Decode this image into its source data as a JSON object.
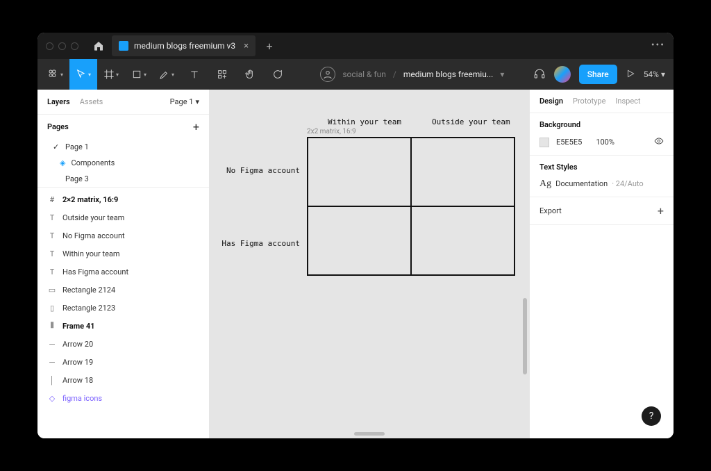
{
  "tabbar": {
    "title": "medium blogs freemium v3"
  },
  "toolbar": {
    "project": "social & fun",
    "file": "medium blogs freemiu...",
    "share": "Share",
    "zoom": "54%"
  },
  "leftPanel": {
    "tabs": {
      "layers": "Layers",
      "assets": "Assets",
      "pagePicker": "Page 1"
    },
    "pagesHeader": "Pages",
    "pages": [
      {
        "label": "Page 1",
        "checked": true
      },
      {
        "label": "Components",
        "component": true
      },
      {
        "label": "Page 3"
      }
    ],
    "layers": [
      {
        "icon": "frame",
        "label": "2×2 matrix, 16:9",
        "bold": true
      },
      {
        "icon": "text",
        "label": "Outside your team"
      },
      {
        "icon": "text",
        "label": "No Figma account"
      },
      {
        "icon": "text",
        "label": "Within your team"
      },
      {
        "icon": "text",
        "label": "Has Figma account"
      },
      {
        "icon": "rect",
        "label": "Rectangle 2124"
      },
      {
        "icon": "rect",
        "label": "Rectangle 2123"
      },
      {
        "icon": "frame41",
        "label": "Frame 41",
        "bold": true
      },
      {
        "icon": "arrow",
        "label": "Arrow 20"
      },
      {
        "icon": "arrow",
        "label": "Arrow 19"
      },
      {
        "icon": "arrow",
        "label": "Arrow 18"
      },
      {
        "icon": "diamond",
        "label": "figma icons",
        "purple": true
      }
    ]
  },
  "canvas": {
    "frameLabel": "2x2 matrix, 16:9",
    "colLabels": [
      "Within your team",
      "Outside your team"
    ],
    "rowLabels": [
      "No Figma account",
      "Has Figma account"
    ]
  },
  "rightPanel": {
    "tabs": {
      "design": "Design",
      "prototype": "Prototype",
      "inspect": "Inspect"
    },
    "background": {
      "title": "Background",
      "hex": "E5E5E5",
      "opacity": "100%"
    },
    "textStyles": {
      "title": "Text Styles",
      "name": "Documentation",
      "size": "· 24/Auto"
    },
    "export": "Export"
  },
  "help": "?"
}
